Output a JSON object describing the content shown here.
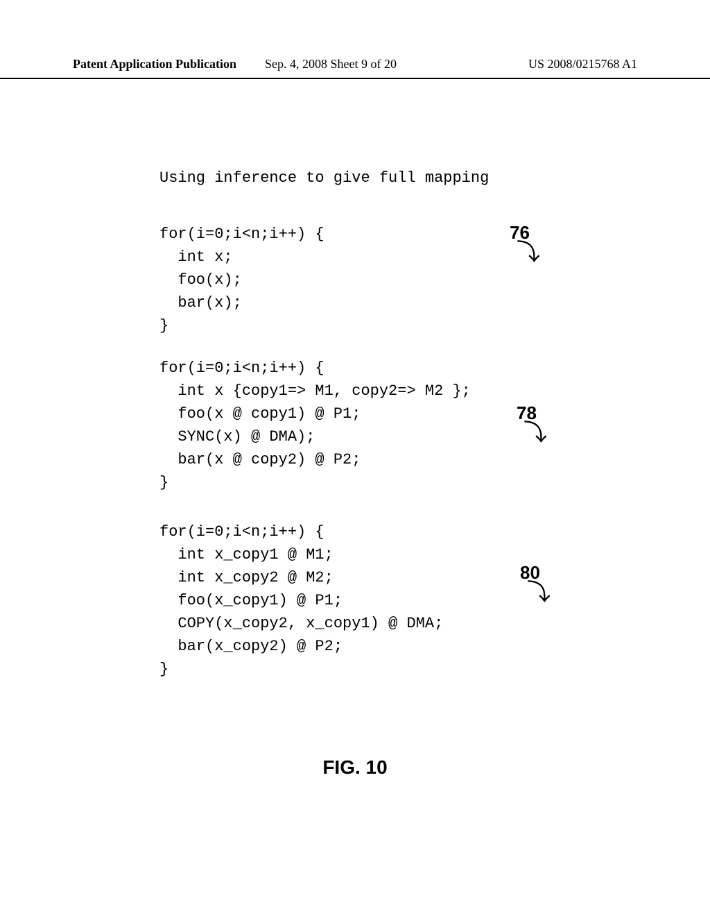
{
  "header": {
    "left": "Patent Application Publication",
    "mid": "Sep. 4, 2008   Sheet 9 of 20",
    "right": "US 2008/0215768 A1"
  },
  "title": "Using inference to give full mapping",
  "code": {
    "block1": "for(i=0;i<n;i++) {\n  int x;\n  foo(x);\n  bar(x);\n}",
    "block2": "for(i=0;i<n;i++) {\n  int x {copy1=> M1, copy2=> M2 };\n  foo(x @ copy1) @ P1;\n  SYNC(x) @ DMA);\n  bar(x @ copy2) @ P2;\n}",
    "block3": "for(i=0;i<n;i++) {\n  int x_copy1 @ M1;\n  int x_copy2 @ M2;\n  foo(x_copy1) @ P1;\n  COPY(x_copy2, x_copy1) @ DMA;\n  bar(x_copy2) @ P2;\n}"
  },
  "callouts": {
    "c1": "76",
    "c2": "78",
    "c3": "80"
  },
  "figure_caption": "FIG. 10"
}
